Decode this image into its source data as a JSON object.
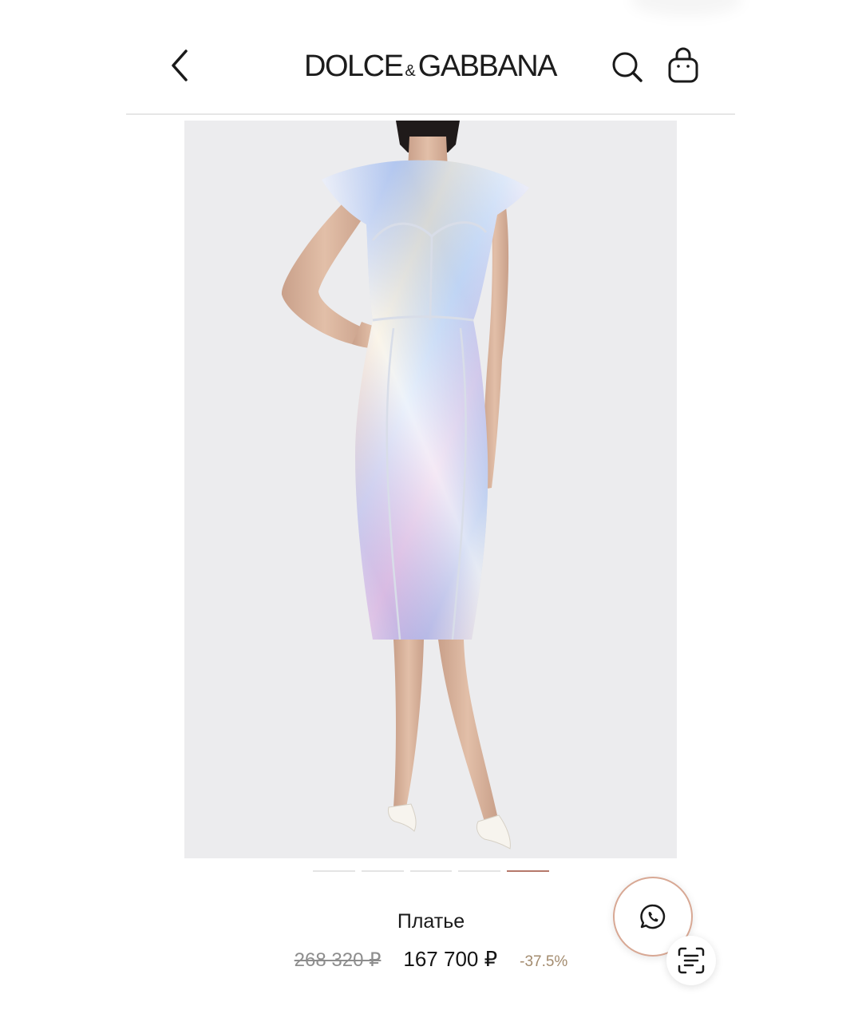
{
  "header": {
    "brand": {
      "part1": "DOLCE",
      "ampersand": "&",
      "part2": "GABBANA"
    },
    "icons": {
      "back": "chevron-left-icon",
      "search": "search-icon",
      "bag": "shopping-bag-icon"
    }
  },
  "gallery": {
    "image_subject": "model wearing holographic silver dress",
    "slide_count": 5,
    "active_slide": 5
  },
  "product": {
    "title": "Платье",
    "old_price": "268 320 ₽",
    "price": "167 700 ₽",
    "discount": "-37.5%"
  },
  "floating": {
    "whatsapp_icon": "whatsapp-icon",
    "scan_icon": "scan-text-icon"
  },
  "colors": {
    "accent": "#b5786b",
    "discount": "#a38b6e",
    "old_price": "#8d8d8d",
    "whatsapp_border": "#d8a894"
  }
}
